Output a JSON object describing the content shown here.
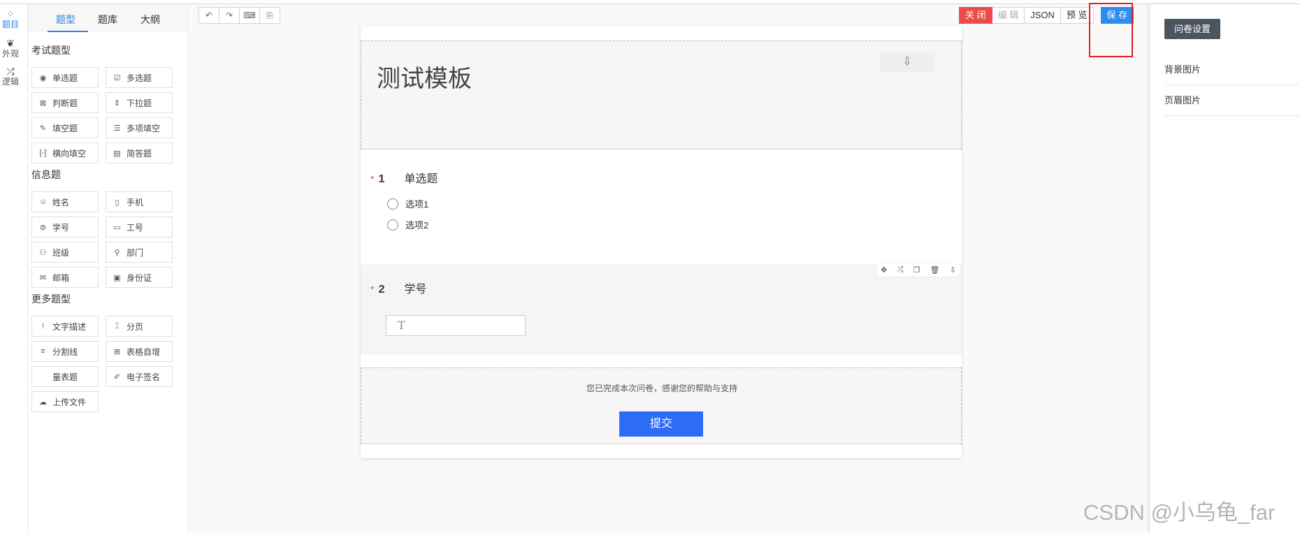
{
  "rail": [
    {
      "label": "题目",
      "icon": "apps-icon"
    },
    {
      "label": "外观",
      "icon": "palette-icon"
    },
    {
      "label": "逻辑",
      "icon": "shuffle-icon"
    }
  ],
  "panel": {
    "tabs": [
      "题型",
      "题库",
      "大纲"
    ],
    "groups": [
      {
        "title": "考试题型",
        "items": [
          {
            "label": "单选题",
            "icon": "◉"
          },
          {
            "label": "多选题",
            "icon": "☑"
          },
          {
            "label": "判断题",
            "icon": "⊠"
          },
          {
            "label": "下拉题",
            "icon": "⇕"
          },
          {
            "label": "填空题",
            "icon": "✎"
          },
          {
            "label": "多项填空",
            "icon": "☰"
          },
          {
            "label": "横向填空",
            "icon": "[-]"
          },
          {
            "label": "简答题",
            "icon": "▤"
          }
        ]
      },
      {
        "title": "信息题",
        "items": [
          {
            "label": "姓名",
            "icon": "☺"
          },
          {
            "label": "手机",
            "icon": "▯"
          },
          {
            "label": "学号",
            "icon": "⊜"
          },
          {
            "label": "工号",
            "icon": "▭"
          },
          {
            "label": "班级",
            "icon": "⚇"
          },
          {
            "label": "部门",
            "icon": "⚲"
          },
          {
            "label": "邮箱",
            "icon": "✉"
          },
          {
            "label": "身份证",
            "icon": "▣"
          }
        ]
      },
      {
        "title": "更多题型",
        "items": [
          {
            "label": "文字描述",
            "icon": "!"
          },
          {
            "label": "分页",
            "icon": "⌶"
          },
          {
            "label": "分割线",
            "icon": "≡"
          },
          {
            "label": "表格自增",
            "icon": "⊞"
          },
          {
            "label": "量表题",
            "icon": ""
          },
          {
            "label": "电子签名",
            "icon": "✐"
          },
          {
            "label": "上传文件",
            "icon": "☁"
          }
        ]
      }
    ]
  },
  "toolbar": {
    "undo_icon": "↶",
    "redo_icon": "↷",
    "keyboard_icon": "⌨",
    "preview_icon": "⎘"
  },
  "actions": {
    "close": "关 闭",
    "edit": "编 辑",
    "json": "JSON",
    "preview": "预 览",
    "save": "保 存"
  },
  "survey": {
    "title": "测试模板",
    "questions": [
      {
        "required_mark": "*",
        "number": "1",
        "title": "单选题",
        "options": [
          "选项1",
          "选项2"
        ]
      },
      {
        "required_mark": "*",
        "number": "2",
        "title": "学号",
        "input_placeholder": "T"
      }
    ],
    "finish_text": "您已完成本次问卷，感谢您的帮助与支持",
    "submit": "提交"
  },
  "settings": {
    "button": "问卷设置",
    "rows": [
      "背景图片",
      "页眉图片"
    ]
  },
  "watermark": "CSDN @小乌龟_far"
}
